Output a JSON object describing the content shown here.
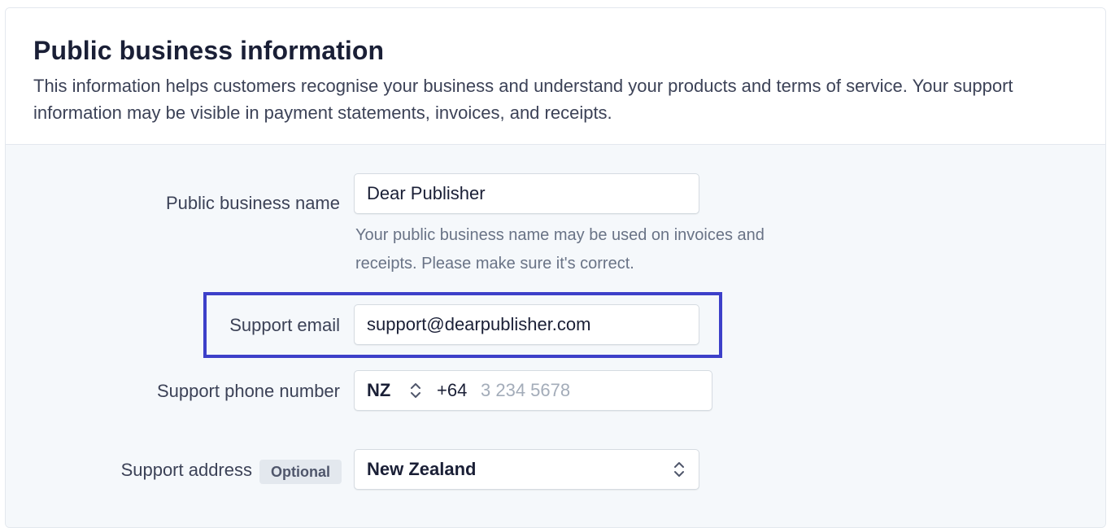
{
  "section": {
    "title": "Public business information",
    "description": "This information helps customers recognise your business and understand your products and terms of service. Your support information may be visible in payment statements, invoices, and receipts."
  },
  "fields": {
    "business_name": {
      "label": "Public business name",
      "value": "Dear Publisher",
      "help": "Your public business name may be used on invoices and receipts. Please make sure it's correct."
    },
    "support_email": {
      "label": "Support email",
      "value": "support@dearpublisher.com"
    },
    "support_phone": {
      "label": "Support phone number",
      "country": "NZ",
      "code": "+64",
      "placeholder": "3 234 5678"
    },
    "support_address": {
      "label": "Support address",
      "badge": "Optional",
      "country": "New Zealand"
    }
  },
  "colors": {
    "highlight": "#3d40c9",
    "body_bg": "#f5f8fb"
  }
}
